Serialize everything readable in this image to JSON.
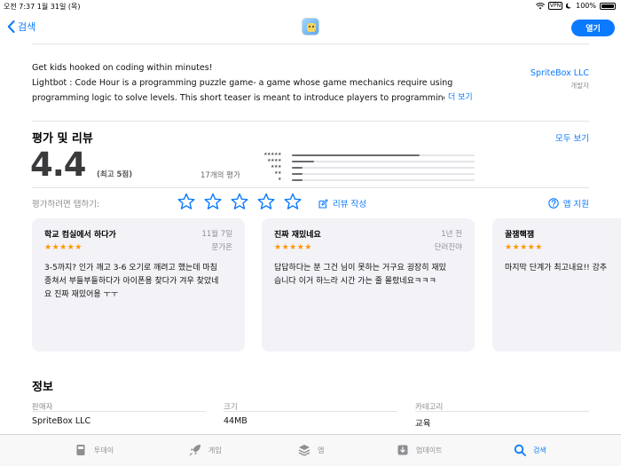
{
  "status": {
    "time": "오전 7:37",
    "date": "1월 31일 (목)",
    "vpn": "VPN",
    "battery": "100%"
  },
  "nav": {
    "back_label": "검색",
    "open_label": "열기"
  },
  "description": {
    "lines": [
      "Get kids hooked on coding within minutes!",
      "Lightbot : Code Hour is a programming puzzle game- a game whose game mechanics require using",
      "programming logic to solve levels. This short teaser is meant to introduce players to programming w"
    ],
    "more": "더 보기",
    "developer": "SpriteBox LLC",
    "developer_role": "개발자"
  },
  "ratings": {
    "title": "평가 및 리뷰",
    "see_all": "모두 보기",
    "score": "4.4",
    "out_of": "(최고 5점)",
    "count": "17개의 평가",
    "distribution": [
      {
        "stars": "★★★★★",
        "fraction": 0.7
      },
      {
        "stars": "★★★★",
        "fraction": 0.12
      },
      {
        "stars": "★★★",
        "fraction": 0.06
      },
      {
        "stars": "★★",
        "fraction": 0.06
      },
      {
        "stars": "★",
        "fraction": 0.06
      }
    ],
    "tap_label": "평가하려면 탭하기:",
    "write_review": "리뷰 작성",
    "app_support": "앱 지원"
  },
  "reviews": [
    {
      "title": "학교 컴실에서 하다가",
      "date": "11월 7일",
      "author": "문가온",
      "stars": "★★★★★",
      "body": [
        "3-5까지? 인가 깨고 3-6 오기로 깨려고 했는데 마침",
        "종쳐서 부들부들하다가 아이폰용 찾다가 겨우 찾았네",
        "요 진짜 재밌어용 ㅜㅜ"
      ]
    },
    {
      "title": "진짜 재밌네요",
      "date": "1년 전",
      "author": "단러진야",
      "stars": "★★★★★",
      "body": [
        "답답하다는 분 그건 님이 못하는 거구요 굉장히 재밌",
        "습니다 이거 하느라 시간 가는 줄 몰랐네요ㅋㅋㅋ"
      ]
    },
    {
      "title": "꿀잼핵잼",
      "date": "",
      "author": "",
      "stars": "★★★★★",
      "body": [
        "마지막 단계가 최고내요!! 강추"
      ]
    }
  ],
  "info": {
    "title": "정보",
    "fields": [
      {
        "label": "판매자",
        "value": "SpriteBox LLC"
      },
      {
        "label": "크기",
        "value": "44MB"
      },
      {
        "label": "카테고리",
        "value": "교육"
      }
    ]
  },
  "tabs": [
    {
      "label": "투데이",
      "icon": "today-icon"
    },
    {
      "label": "게임",
      "icon": "rocket-icon"
    },
    {
      "label": "앱",
      "icon": "layers-icon"
    },
    {
      "label": "업데이트",
      "icon": "download-icon"
    },
    {
      "label": "검색",
      "icon": "search-icon"
    }
  ],
  "colors": {
    "accent": "#0a7aff",
    "star": "#ff9500",
    "card_bg": "#f2f2f7"
  }
}
